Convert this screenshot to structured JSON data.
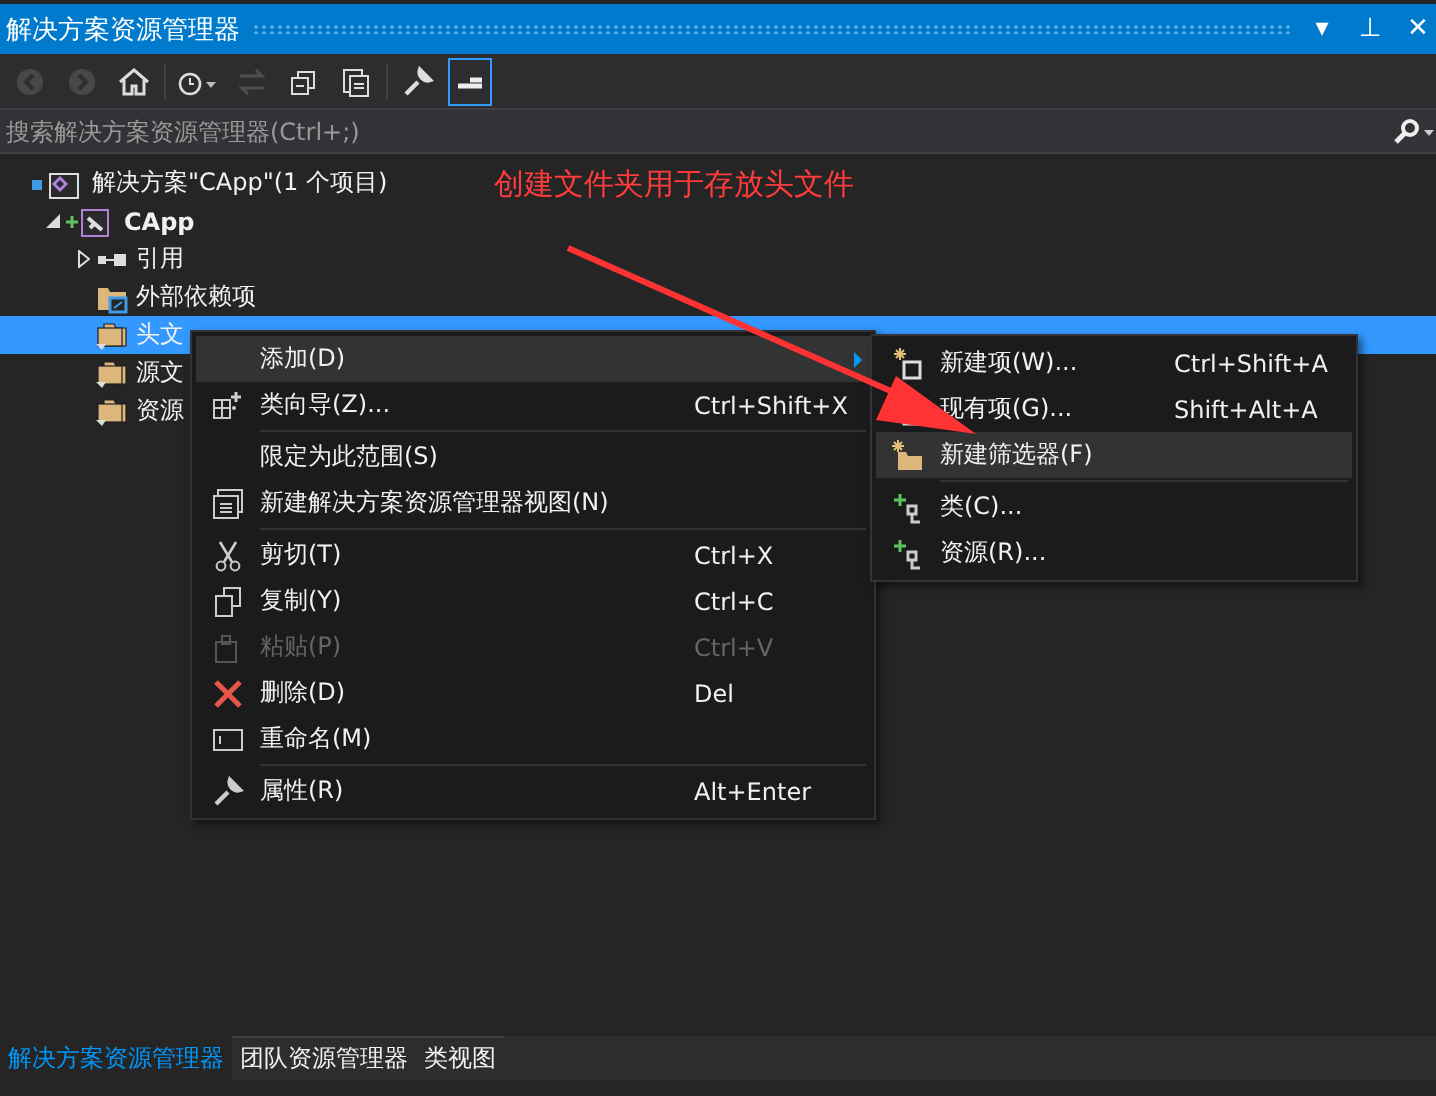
{
  "window": {
    "title": "解决方案资源管理器",
    "controls": [
      "▾",
      "⊥",
      "✕"
    ]
  },
  "toolbar": [
    {
      "disabled": true,
      "selected": false
    },
    {
      "disabled": true,
      "selected": false
    },
    {
      "disabled": false,
      "selected": false
    },
    {
      "disabled": false,
      "selected": false
    },
    {
      "disabled": true,
      "selected": false
    },
    {
      "disabled": false,
      "selected": false
    },
    {
      "disabled": false,
      "selected": false
    },
    {
      "disabled": false,
      "selected": false
    },
    {
      "disabled": false,
      "selected": true
    }
  ],
  "search": {
    "placeholder": "搜索解决方案资源管理器(Ctrl+;)"
  },
  "tree": [
    {
      "label": "解决方案\"CApp\"(1 个项目)",
      "selected": false,
      "children": [
        {
          "label": "CApp",
          "selected": false,
          "expanded": true,
          "children": [
            {
              "label": "引用",
              "selected": false,
              "expanded": false
            },
            {
              "label": "外部依赖项",
              "selected": false
            },
            {
              "label": "头文",
              "selected": true
            },
            {
              "label": "源文",
              "selected": false
            },
            {
              "label": "资源",
              "selected": false
            }
          ]
        }
      ]
    }
  ],
  "annotation": "创建文件夹用于存放头文件",
  "context_menu": [
    {
      "kind": "item",
      "label": "添加(D)",
      "selected": true,
      "submenu": true,
      "disabled": false
    },
    {
      "kind": "item",
      "label": "类向导(Z)...",
      "shortcut": "Ctrl+Shift+X",
      "selected": false,
      "disabled": false
    },
    {
      "kind": "separator"
    },
    {
      "kind": "item",
      "label": "限定为此范围(S)",
      "selected": false,
      "disabled": false
    },
    {
      "kind": "item",
      "label": "新建解决方案资源管理器视图(N)",
      "selected": false,
      "disabled": false
    },
    {
      "kind": "separator"
    },
    {
      "kind": "item",
      "label": "剪切(T)",
      "shortcut": "Ctrl+X",
      "selected": false,
      "disabled": false
    },
    {
      "kind": "item",
      "label": "复制(Y)",
      "shortcut": "Ctrl+C",
      "selected": false,
      "disabled": false
    },
    {
      "kind": "item",
      "label": "粘贴(P)",
      "shortcut": "Ctrl+V",
      "selected": false,
      "disabled": true
    },
    {
      "kind": "item",
      "label": "删除(D)",
      "shortcut": "Del",
      "selected": false,
      "disabled": false
    },
    {
      "kind": "item",
      "label": "重命名(M)",
      "selected": false,
      "disabled": false
    },
    {
      "kind": "separator"
    },
    {
      "kind": "item",
      "label": "属性(R)",
      "shortcut": "Alt+Enter",
      "selected": false,
      "disabled": false
    }
  ],
  "submenu": [
    {
      "kind": "item",
      "label": "新建项(W)...",
      "shortcut": "Ctrl+Shift+A",
      "selected": false,
      "disabled": false
    },
    {
      "kind": "item",
      "label": "现有项(G)...",
      "shortcut": "Shift+Alt+A",
      "selected": false,
      "disabled": false
    },
    {
      "kind": "item",
      "label": "新建筛选器(F)",
      "selected": true,
      "disabled": false
    },
    {
      "kind": "separator"
    },
    {
      "kind": "item",
      "label": "类(C)...",
      "selected": false,
      "disabled": false
    },
    {
      "kind": "item",
      "label": "资源(R)...",
      "selected": false,
      "disabled": false
    }
  ],
  "bottom_tabs": [
    {
      "label": "解决方案资源管理器",
      "selected": true
    },
    {
      "label": "团队资源管理器",
      "selected": false
    },
    {
      "label": "类视图",
      "selected": false
    }
  ]
}
